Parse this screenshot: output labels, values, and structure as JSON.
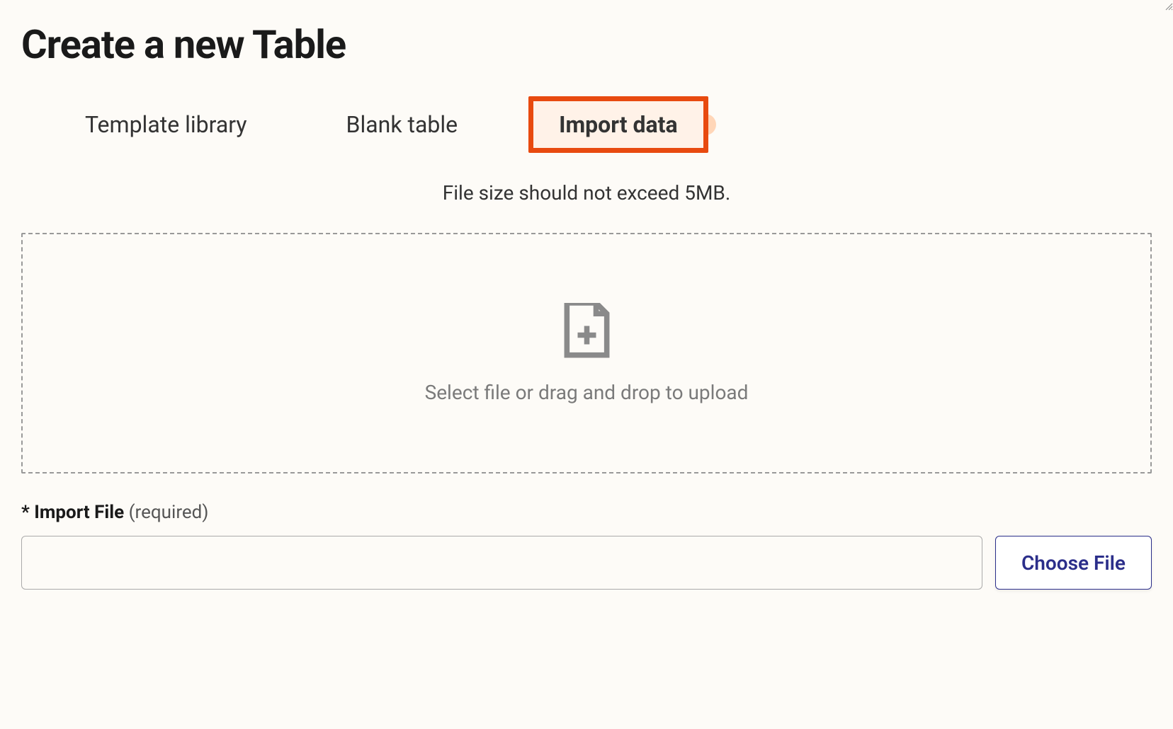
{
  "title": "Create a new Table",
  "tabs": [
    {
      "label": "Template library"
    },
    {
      "label": "Blank table"
    },
    {
      "label": "Import data",
      "active": true
    }
  ],
  "hint": "File size should not exceed 5MB.",
  "dropzone": {
    "text": "Select file or drag and drop to upload",
    "icon": "file-add-icon"
  },
  "file_field": {
    "required_mark": "*",
    "label": "Import File",
    "required_text": "(required)",
    "value": "",
    "button_label": "Choose File"
  },
  "colors": {
    "highlight_border": "#e84a0f",
    "highlight_bg": "#fff2e8",
    "button_border": "#2b2e8a",
    "button_text": "#2b2e8a"
  }
}
